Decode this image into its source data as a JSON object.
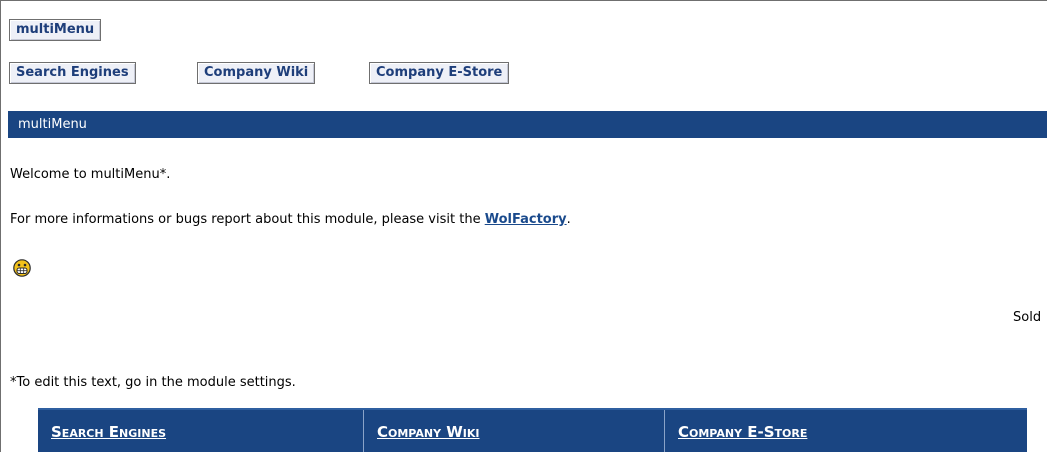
{
  "module_title_button": {
    "label": "multiMenu"
  },
  "top_menu": [
    {
      "label": "Search Engines"
    },
    {
      "label": "Company Wiki"
    },
    {
      "label": "Company E-Store"
    }
  ],
  "module_header": {
    "title": "multiMenu"
  },
  "content": {
    "welcome": "Welcome to multiMenu*.",
    "info_prefix": "For more informations or bugs report about this module, please visit the ",
    "info_link": "WolFactory",
    "info_suffix": ".",
    "right_clipped": "Sold",
    "note": "*To edit this text, go in the module settings."
  },
  "emoticon": {
    "icon": "grinning-smiley-icon"
  },
  "bottom_menu": [
    {
      "label": "Search Engines"
    },
    {
      "label": "Company Wiki"
    },
    {
      "label": "Company E-Store"
    }
  ],
  "colors": {
    "header_blue": "#1a4582",
    "link_blue": "#1a4a8c",
    "button_text": "#1e3e7a",
    "button_bg": "#eef0f7"
  }
}
